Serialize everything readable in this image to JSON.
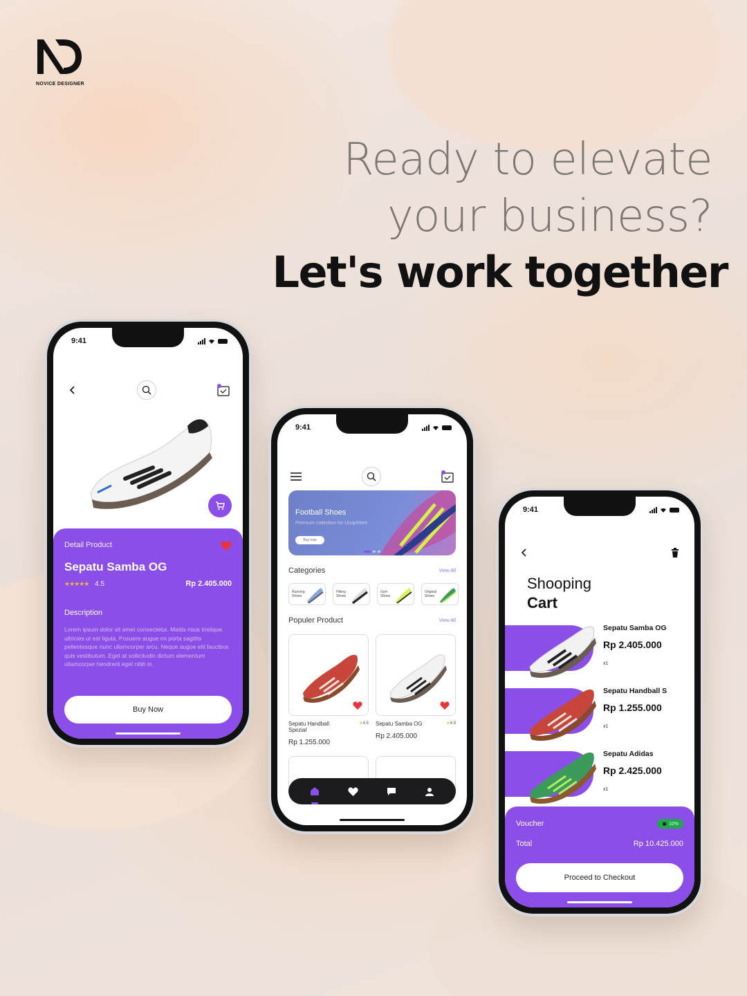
{
  "brand": {
    "logo_text": "NOVICE DESIGNER"
  },
  "headline": {
    "line1": "Ready to elevate",
    "line2": "your business?",
    "line3": "Let's work together"
  },
  "colors": {
    "accent": "#8b4ee8",
    "heart": "#e8343b",
    "star": "#f5b43a",
    "voucher": "#22a84a"
  },
  "status_bar": {
    "time": "9:41"
  },
  "detail_screen": {
    "section_label": "Detail Product",
    "product_name": "Sepatu Samba OG",
    "stars": "★★★★★",
    "rating": "4.5",
    "price": "Rp 2.405.000",
    "description_title": "Description",
    "description": "Lorem ipsum dolor sit amet consectetur. Mattis risus tristique ultricies ut est ligula. Posuere augue mi porta sagittis pellentesque nunc ullamcorper arcu. Neque augue elit faucibus quis vestibulum. Eget at sollicitudin dictum elementum ullamcorper hendrerit eget nibh in.",
    "buy_button": "Buy Now"
  },
  "home_screen": {
    "banner": {
      "title": "Football Shoes",
      "subtitle": "Premium collection for UcupStore",
      "button": "Buy now"
    },
    "categories_title": "Categories",
    "categories_view_all": "View All",
    "categories": [
      {
        "label": "Running Shoes"
      },
      {
        "label": "Hiking Shoes"
      },
      {
        "label": "Gym Shoes"
      },
      {
        "label": "Original Shoes"
      }
    ],
    "popular_title": "Populer Product",
    "popular_view_all": "View All",
    "products": [
      {
        "name": "Sepatu Handball Spezial",
        "rating": "4.5",
        "price": "Rp 1.255.000"
      },
      {
        "name": "Sepatu Samba OG",
        "rating": "4.9",
        "price": "Rp 2.405.000"
      }
    ],
    "nav": [
      "home-icon",
      "heart-icon",
      "chat-icon",
      "profile-icon"
    ]
  },
  "cart_screen": {
    "title_line1": "Shooping",
    "title_line2": "Cart",
    "items": [
      {
        "name": "Sepatu Samba OG",
        "price": "Rp 2.405.000",
        "qty": "x1"
      },
      {
        "name": "Sepatu Handball S",
        "price": "Rp 1.255.000",
        "qty": "x1"
      },
      {
        "name": "Sepatu Adidas",
        "price": "Rp 2.425.000",
        "qty": "x1"
      }
    ],
    "voucher_label": "Voucher",
    "voucher_value": "10%",
    "total_label": "Total",
    "total_value": "Rp 10.425.000",
    "checkout_button": "Proceed to Checkout"
  }
}
